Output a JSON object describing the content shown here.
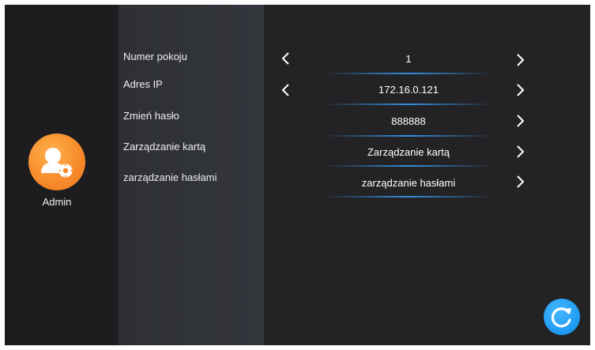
{
  "user": {
    "name": "Admin",
    "avatar_icon": "user-settings-icon"
  },
  "settings": [
    {
      "label": "Numer pokoju",
      "value": "1"
    },
    {
      "label": "Adres IP",
      "value": "172.16.0.121"
    },
    {
      "label": "Zmień hasło",
      "value": "888888"
    },
    {
      "label": "Zarządzanie kartą",
      "value": "Zarządzanie kartą"
    },
    {
      "label": "zarządzanie hasłami",
      "value": "zarządzanie hasłami"
    }
  ],
  "actions": {
    "refresh_icon": "refresh-icon"
  },
  "colors": {
    "background": "#232325",
    "left_panel": "#1d1d1f",
    "label_panel": "#31343a",
    "avatar": "#f7892a",
    "accent": "#1d9af2"
  }
}
